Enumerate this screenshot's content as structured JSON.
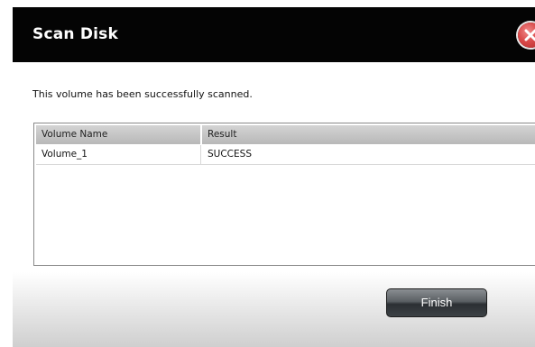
{
  "dialog": {
    "title": "Scan Disk",
    "message": "This volume has been successfully scanned.",
    "close_icon": "close-icon"
  },
  "table": {
    "columns": [
      "Volume Name",
      "Result"
    ],
    "rows": [
      [
        "Volume_1",
        "SUCCESS"
      ]
    ]
  },
  "footer": {
    "finish_label": "Finish"
  },
  "colors": {
    "titlebar": "#040404",
    "close": "#d94a4a"
  }
}
